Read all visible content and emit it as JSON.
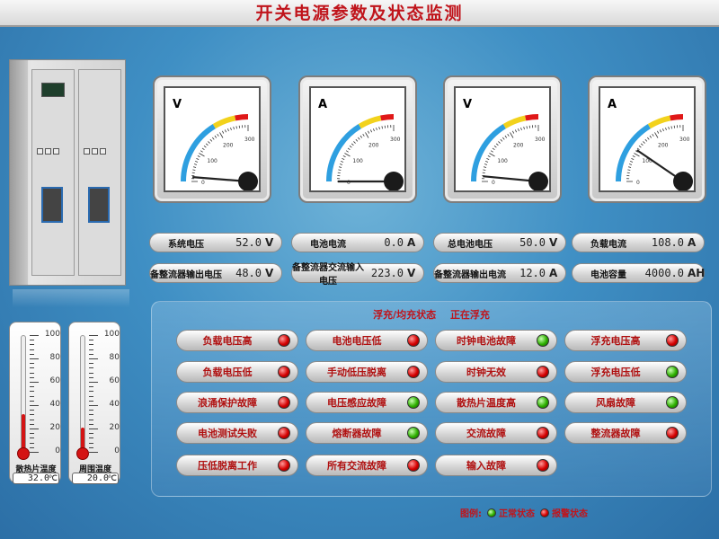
{
  "title": "开关电源参数及状态监测",
  "meters": [
    {
      "unit": "V",
      "ticks": [
        "0",
        "100",
        "200",
        "300"
      ],
      "needle": 0.05
    },
    {
      "unit": "A",
      "ticks": [
        "0",
        "100",
        "200",
        "300"
      ],
      "needle": 0.0
    },
    {
      "unit": "V",
      "ticks": [
        "0",
        "100",
        "200",
        "300"
      ],
      "needle": 0.06
    },
    {
      "unit": "A",
      "ticks": [
        "0",
        "100",
        "200",
        "300"
      ],
      "needle": 0.38
    }
  ],
  "readouts": [
    {
      "label": "系统电压",
      "value": "52.0",
      "unit": "V"
    },
    {
      "label": "电池电流",
      "value": "0.0",
      "unit": "A"
    },
    {
      "label": "总电池电压",
      "value": "50.0",
      "unit": "V"
    },
    {
      "label": "负载电流",
      "value": "108.0",
      "unit": "A"
    },
    {
      "label": "备整流器输出电压",
      "value": "48.0",
      "unit": "V"
    },
    {
      "label": "备整流器交流输入电压",
      "value": "223.0",
      "unit": "V"
    },
    {
      "label": "备整流器输出电流",
      "value": "12.0",
      "unit": "A"
    },
    {
      "label": "电池容量",
      "value": "4000.0",
      "unit": "AH"
    }
  ],
  "thermometers": [
    {
      "name": "散热片温度",
      "value": "32.0",
      "unit": "℃",
      "level": 0.32,
      "ticks": [
        "100",
        "80",
        "60",
        "40",
        "20",
        "0"
      ]
    },
    {
      "name": "周围温度",
      "value": "20.0",
      "unit": "℃",
      "level": 0.2,
      "ticks": [
        "100",
        "80",
        "60",
        "40",
        "20",
        "0"
      ]
    }
  ],
  "mode": {
    "label": "浮充/均充状态",
    "state": "正在浮充"
  },
  "alarms": [
    {
      "label": "负载电压高",
      "status": "red"
    },
    {
      "label": "电池电压低",
      "status": "red"
    },
    {
      "label": "时钟电池故障",
      "status": "green"
    },
    {
      "label": "浮充电压高",
      "status": "red"
    },
    {
      "label": "负载电压低",
      "status": "red"
    },
    {
      "label": "手动低压脱离",
      "status": "red"
    },
    {
      "label": "时钟无效",
      "status": "red"
    },
    {
      "label": "浮充电压低",
      "status": "green"
    },
    {
      "label": "浪涌保护故障",
      "status": "red"
    },
    {
      "label": "电压感应故障",
      "status": "green"
    },
    {
      "label": "散热片温度高",
      "status": "green"
    },
    {
      "label": "风扇故障",
      "status": "green"
    },
    {
      "label": "电池测试失败",
      "status": "red"
    },
    {
      "label": "熔断器故障",
      "status": "green"
    },
    {
      "label": "交流故障",
      "status": "red"
    },
    {
      "label": "整流器故障",
      "status": "red"
    },
    {
      "label": "压低脱离工作",
      "status": "red"
    },
    {
      "label": "所有交流故障",
      "status": "red"
    },
    {
      "label": "输入故障",
      "status": "red"
    }
  ],
  "legend": {
    "title": "图例:",
    "normal": "正常状态",
    "alarm": "报警状态"
  },
  "colors": {
    "title": "#c0141b",
    "alarm_text": "#b01010",
    "lamp_red": "#d40000",
    "lamp_green": "#2eb000"
  }
}
